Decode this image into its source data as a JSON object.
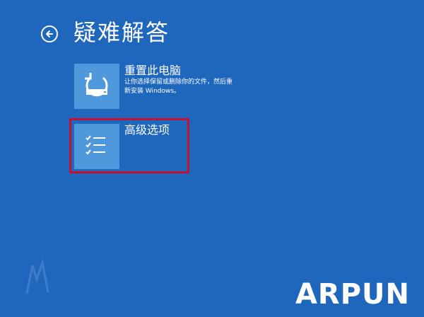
{
  "page": {
    "title": "疑难解答"
  },
  "options": [
    {
      "title": "重置此电脑",
      "description": "让你选择保留或删除你的文件，然后重新安装 Windows。"
    },
    {
      "title": "高级选项"
    }
  ],
  "watermark": {
    "text": "ARPUN"
  },
  "colors": {
    "background": "#1f66bd",
    "tile": "#4f98dc",
    "highlight": "#c8102e"
  }
}
